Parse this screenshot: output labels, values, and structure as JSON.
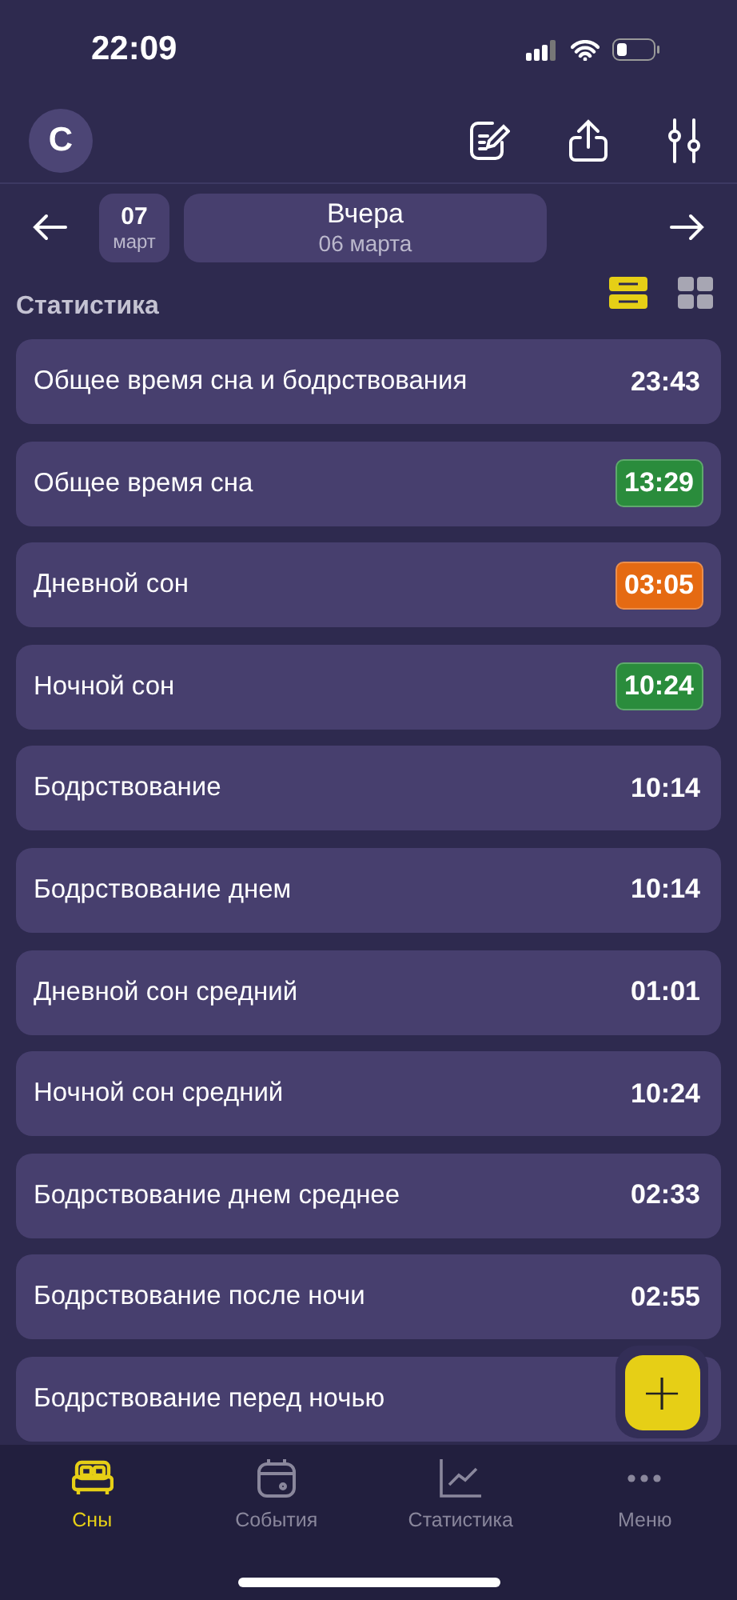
{
  "status_bar": {
    "time": "22:09"
  },
  "header": {
    "avatar": "С"
  },
  "date_nav": {
    "day": "07",
    "month": "март",
    "title": "Вчера",
    "subtitle": "06 марта"
  },
  "section": {
    "title": "Статистика",
    "view_modes": [
      {
        "kind": "list",
        "selected": true
      },
      {
        "kind": "grid",
        "selected": false
      }
    ]
  },
  "stats": [
    {
      "label": "Общее время сна и бодрствования",
      "value": "23:43"
    },
    {
      "label": "Общее время сна",
      "value": "13:29",
      "color": "#2a8c3c"
    },
    {
      "label": "Дневной сон",
      "value": "03:05",
      "color": "#e56a12"
    },
    {
      "label": "Ночной сон",
      "value": "10:24",
      "color": "#2a8c3c"
    },
    {
      "label": "Бодрствование",
      "value": "10:14"
    },
    {
      "label": "Бодрствование днем",
      "value": "10:14"
    },
    {
      "label": "Дневной сон средний",
      "value": "01:01"
    },
    {
      "label": "Ночной сон средний",
      "value": "10:24"
    },
    {
      "label": "Бодрствование днем среднее",
      "value": "02:33"
    },
    {
      "label": "Бодрствование после ночи",
      "value": "02:55"
    },
    {
      "label": "Бодрствование перед ночью"
    }
  ],
  "fab": {
    "label": "+"
  },
  "tab_bar": [
    {
      "kind": "bed",
      "label": "Сны",
      "selected": true
    },
    {
      "kind": "calendar",
      "label": "События",
      "selected": false
    },
    {
      "kind": "chart",
      "label": "Статистика",
      "selected": false
    },
    {
      "kind": "more",
      "label": "Меню",
      "selected": false
    }
  ]
}
